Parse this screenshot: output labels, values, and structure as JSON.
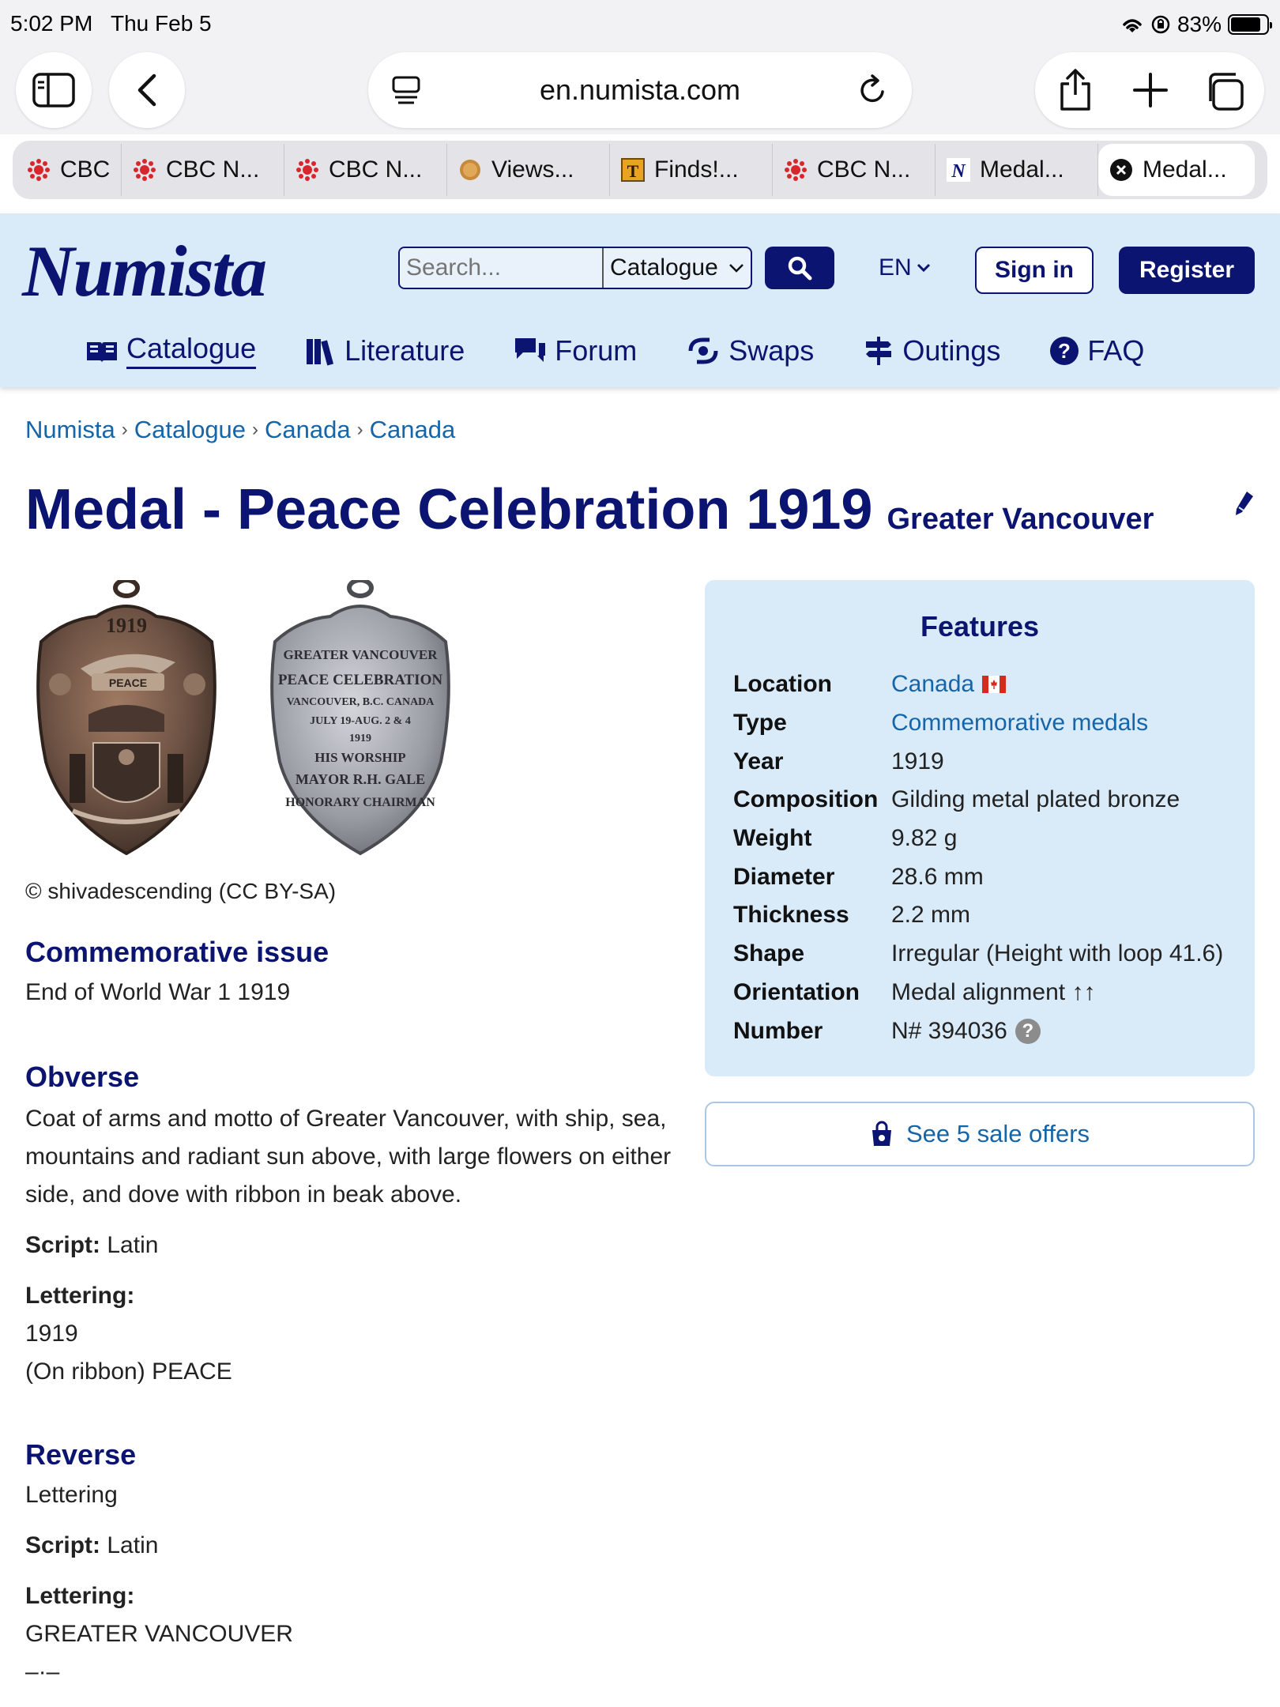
{
  "status": {
    "time": "5:02 PM",
    "date": "Thu Feb 5",
    "battery": "83%",
    "battery_level": 0.83
  },
  "browser": {
    "url": "en.numista.com",
    "tabs": [
      {
        "label": "CBC",
        "icon": "cbc-gem-icon"
      },
      {
        "label": "CBC N...",
        "icon": "cbc-gem-icon"
      },
      {
        "label": "CBC N...",
        "icon": "cbc-gem-icon"
      },
      {
        "label": "Views...",
        "icon": "coin-icon"
      },
      {
        "label": "Finds!...",
        "icon": "t-icon"
      },
      {
        "label": "CBC N...",
        "icon": "cbc-gem-icon"
      },
      {
        "label": "Medal...",
        "icon": "numista-n-icon"
      },
      {
        "label": "Medal...",
        "icon": "close-icon",
        "active": true
      }
    ]
  },
  "header": {
    "logo": "Numista",
    "search_placeholder": "Search...",
    "search_scope": "Catalogue",
    "language": "EN",
    "sign_in": "Sign in",
    "register": "Register",
    "nav": [
      {
        "label": "Catalogue",
        "icon": "book-icon"
      },
      {
        "label": "Literature",
        "icon": "books-icon"
      },
      {
        "label": "Forum",
        "icon": "chat-icon"
      },
      {
        "label": "Swaps",
        "icon": "swap-icon"
      },
      {
        "label": "Outings",
        "icon": "signpost-icon"
      },
      {
        "label": "FAQ",
        "icon": "question-icon"
      }
    ]
  },
  "breadcrumb": [
    "Numista",
    "Catalogue",
    "Canada",
    "Canada"
  ],
  "title": {
    "main": "Medal - Peace Celebration 1919",
    "sub": "Greater Vancouver"
  },
  "image_credit": "© shivadescending (CC BY-SA)",
  "commemorative": {
    "heading": "Commemorative issue",
    "text": "End of World War 1 1919"
  },
  "obverse": {
    "heading": "Obverse",
    "description_1": "Coat of arms and motto of Greater Vancouver, with ship, sea,",
    "description_2": "mountains and radiant sun above, with large flowers on either",
    "description_3": "side, and dove with ribbon in beak above.",
    "script_label": "Script:",
    "script": "Latin",
    "lettering_label": "Lettering:",
    "lettering_1": "1919",
    "lettering_2": "(On ribbon) PEACE",
    "coin_text_top": "1919",
    "coin_text_ribbon": "PEACE"
  },
  "reverse": {
    "heading": "Reverse",
    "description": "Lettering",
    "script_label": "Script:",
    "script": "Latin",
    "lettering_label": "Lettering:",
    "lettering_1": "GREATER VANCOUVER",
    "lettering_2": "–·–",
    "coin_lines": [
      "GREATER VANCOUVER",
      "PEACE CELEBRATION",
      "VANCOUVER, B.C. CANADA",
      "JULY 19-AUG. 2 & 4",
      "1919",
      "HIS WORSHIP",
      "MAYOR R.H. GALE",
      "HONORARY CHAIRMAN"
    ]
  },
  "features": {
    "title": "Features",
    "rows": [
      {
        "key": "Location",
        "value": "Canada",
        "link": true,
        "flag": true
      },
      {
        "key": "Type",
        "value": "Commemorative medals",
        "link": true
      },
      {
        "key": "Year",
        "value": "1919"
      },
      {
        "key": "Composition",
        "value": "Gilding metal plated bronze"
      },
      {
        "key": "Weight",
        "value": "9.82 g"
      },
      {
        "key": "Diameter",
        "value": "28.6 mm"
      },
      {
        "key": "Thickness",
        "value": "2.2 mm"
      },
      {
        "key": "Shape",
        "value": "Irregular (Height with loop 41.6)"
      },
      {
        "key": "Orientation",
        "value": "Medal alignment ↑↑"
      },
      {
        "key": "Number",
        "value": "N# 394036",
        "help": "?"
      }
    ]
  },
  "offers": {
    "label": "See 5 sale offers"
  },
  "colors": {
    "brand_navy": "#0b1470",
    "header_bg": "#d9eaf9",
    "link_blue": "#1565a8"
  }
}
